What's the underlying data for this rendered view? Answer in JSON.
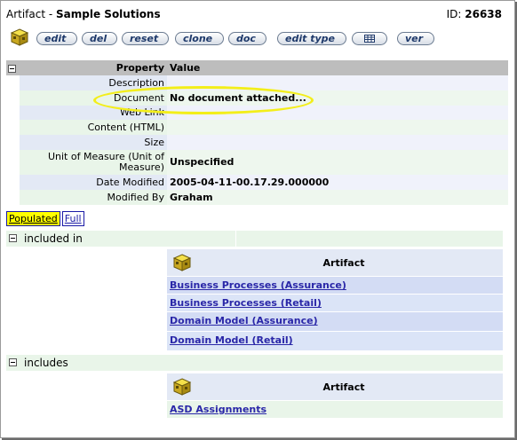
{
  "header": {
    "type_label": "Artifact",
    "separator": " - ",
    "name": "Sample Solutions",
    "id_label": "ID:",
    "id_value": "26638"
  },
  "toolbar": {
    "edit": "edit",
    "del": "del",
    "reset": "reset",
    "clone": "clone",
    "doc": "doc",
    "edit_type": "edit type",
    "grid_icon": "grid-icon",
    "ver": "ver"
  },
  "properties": {
    "header_property": "Property",
    "header_value": "Value",
    "rows": [
      {
        "label": "Description",
        "value": ""
      },
      {
        "label": "Document",
        "value": "No document attached..."
      },
      {
        "label": "Web Link",
        "value": ""
      },
      {
        "label": "Content (HTML)",
        "value": ""
      },
      {
        "label": "Size",
        "value": ""
      },
      {
        "label": "Unit of Measure (Unit of Measure)",
        "value": "Unspecified"
      },
      {
        "label": "Date Modified",
        "value": "2005-04-11-00.17.29.000000"
      },
      {
        "label": "Modified By",
        "value": "Graham"
      }
    ]
  },
  "tabs": {
    "populated": "Populated",
    "full": "Full"
  },
  "included_in": {
    "title": "included in",
    "column_header": "Artifact",
    "items": [
      "Business Processes (Assurance)",
      "Business Processes (Retail)",
      "Domain Model (Assurance)",
      "Domain Model (Retail)"
    ]
  },
  "includes": {
    "title": "includes",
    "column_header": "Artifact",
    "items": [
      "ASD Assignments"
    ]
  },
  "colors": {
    "highlight": "#f3ee1a",
    "link": "#2a27a8",
    "table_header": "#bdbdbd"
  }
}
